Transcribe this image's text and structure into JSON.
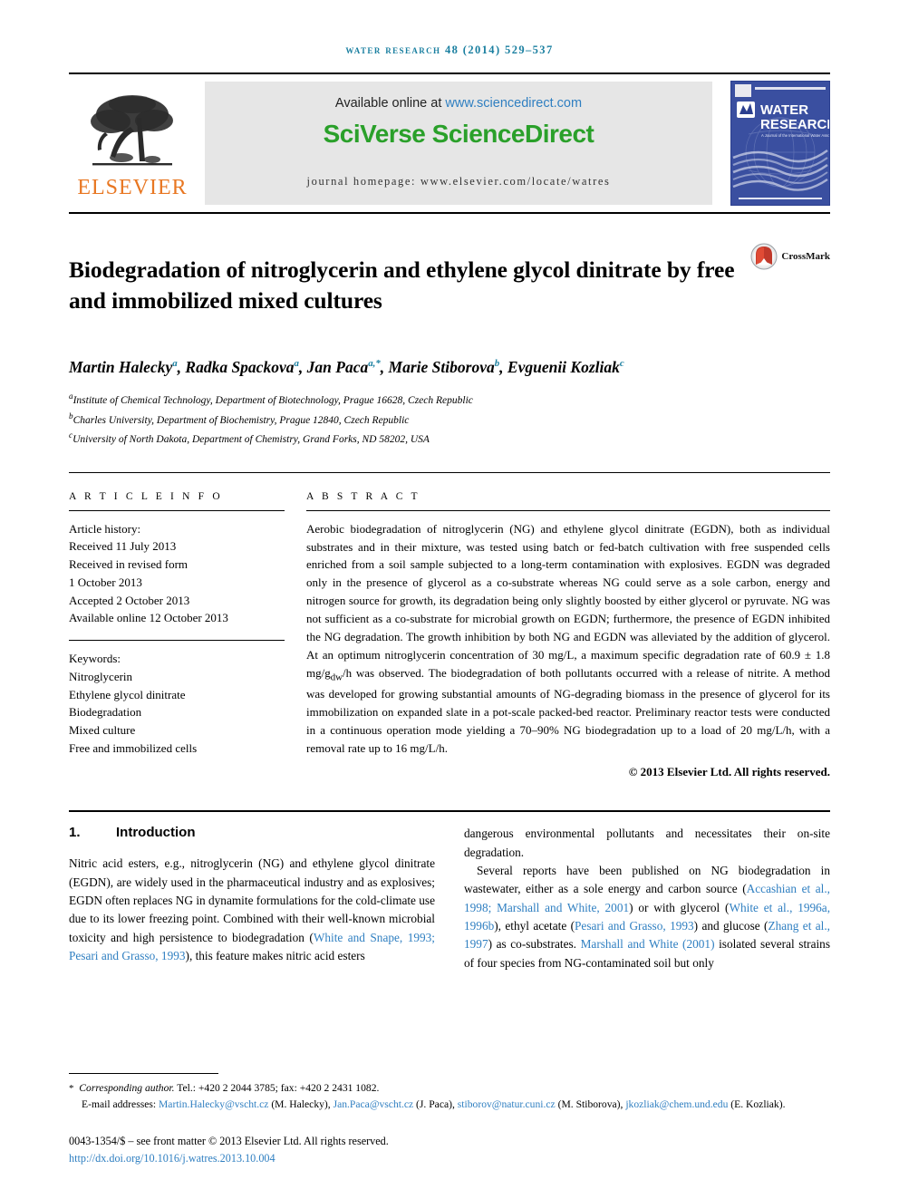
{
  "running_head": "WATER RESEARCH 48 (2014) 529–537",
  "masthead": {
    "publisher_logo_text": "ELSEVIER",
    "available_online_prefix": "Available online at ",
    "available_online_url": "www.sciencedirect.com",
    "sciencedirect_logo": "SciVerse ScienceDirect",
    "journal_homepage": "journal homepage: www.elsevier.com/locate/watres",
    "cover": {
      "journal_title_line1": "WATER",
      "journal_title_line2": "RESEARCH",
      "association_line": "A Journal of the International Water Association",
      "badge": "IWA"
    }
  },
  "article": {
    "title": "Biodegradation of nitroglycerin and ethylene glycol dinitrate by free and immobilized mixed cultures",
    "crossmark_label": "CrossMark",
    "authors_html": "Martin Halecky<sup>a</sup>, Radka Spackova<sup>a</sup>, Jan Paca<sup>a,*</sup>, Marie Stiborova<sup>b</sup>, Evguenii Kozliak<sup>c</sup>",
    "affiliations": [
      {
        "marker": "a",
        "text": "Institute of Chemical Technology, Department of Biotechnology, Prague 16628, Czech Republic"
      },
      {
        "marker": "b",
        "text": "Charles University, Department of Biochemistry, Prague 12840, Czech Republic"
      },
      {
        "marker": "c",
        "text": "University of North Dakota, Department of Chemistry, Grand Forks, ND 58202, USA"
      }
    ]
  },
  "article_info": {
    "label": "A R T I C L E  I N F O",
    "history_label": "Article history:",
    "history": [
      "Received 11 July 2013",
      "Received in revised form",
      "1 October 2013",
      "Accepted 2 October 2013",
      "Available online 12 October 2013"
    ],
    "keywords_label": "Keywords:",
    "keywords": [
      "Nitroglycerin",
      "Ethylene glycol dinitrate",
      "Biodegradation",
      "Mixed culture",
      "Free and immobilized cells"
    ]
  },
  "abstract": {
    "label": "A B S T R A C T",
    "text_html": "Aerobic biodegradation of nitroglycerin (NG) and ethylene glycol dinitrate (EGDN), both as individual substrates and in their mixture, was tested using batch or fed-batch cultivation with free suspended cells enriched from a soil sample subjected to a long-term contamination with explosives. EGDN was degraded only in the presence of glycerol as a co-substrate whereas NG could serve as a sole carbon, energy and nitrogen source for growth, its degradation being only slightly boosted by either glycerol or pyruvate. NG was not sufficient as a co-substrate for microbial growth on EGDN; furthermore, the presence of EGDN inhibited the NG degradation. The growth inhibition by both NG and EGDN was alleviated by the addition of glycerol. At an optimum nitroglycerin concentration of 30 mg/L, a maximum specific degradation rate of 60.9 &plusmn; 1.8 mg/g<sub>dw</sub>/h was observed. The biodegradation of both pollutants occurred with a release of nitrite. A method was developed for growing substantial amounts of NG-degrading biomass in the presence of glycerol for its immobilization on expanded slate in a pot-scale packed-bed reactor. Preliminary reactor tests were conducted in a continuous operation mode yielding a 70–90% NG biodegradation up to a load of 20 mg/L/h, with a removal rate up to 16 mg/L/h.",
    "copyright": "© 2013 Elsevier Ltd. All rights reserved."
  },
  "body": {
    "section_number": "1.",
    "section_title": "Introduction",
    "left_column_html": "Nitric acid esters, e.g., nitroglycerin (NG) and ethylene glycol dinitrate (EGDN), are widely used in the pharmaceutical industry and as explosives; EGDN often replaces NG in dynamite formulations for the cold-climate use due to its lower freezing point. Combined with their well-known microbial toxicity and high persistence to biodegradation (<span class=\"ref\">White and Snape, 1993; Pesari and Grasso, 1993</span>), this feature makes nitric acid esters",
    "right_column_p1_html": "dangerous environmental pollutants and necessitates their on-site degradation.",
    "right_column_p2_html": "Several reports have been published on NG biodegradation in wastewater, either as a sole energy and carbon source (<span class=\"ref\">Accashian et al., 1998; Marshall and White, 2001</span>) or with glycerol (<span class=\"ref\">White et al., 1996a, 1996b</span>), ethyl acetate (<span class=\"ref\">Pesari and Grasso, 1993</span>) and glucose (<span class=\"ref\">Zhang et al., 1997</span>) as co-substrates. <span class=\"ref\">Marshall and White (2001)</span> isolated several strains of four species from NG-contaminated soil but only"
  },
  "footer": {
    "corresponding_html": "<span class=\"star\">*</span>&nbsp; <span class=\"foot-corr\">Corresponding author.</span> Tel.: +420 2 2044 3785; fax: +420 2 2431 1082.",
    "emails_html": "E-mail addresses: <span class=\"email\">Martin.Halecky@vscht.cz</span> (M. Halecky), <span class=\"email\">Jan.Paca@vscht.cz</span> (J. Paca), <span class=\"email\">stiborov@natur.cuni.cz</span> (M. Stiborova), <span class=\"email\">jkozliak@chem.und.edu</span> (E. Kozliak).",
    "issn_line": "0043-1354/$ – see front matter © 2013 Elsevier Ltd. All rights reserved.",
    "doi": "http://dx.doi.org/10.1016/j.watres.2013.10.004"
  },
  "colors": {
    "link_blue": "#2f7fc1",
    "running_head_teal": "#1a7fa0",
    "sciencedirect_green": "#2aa02a",
    "elsevier_orange": "#E87722",
    "cover_blue": "#3a4fa0"
  }
}
